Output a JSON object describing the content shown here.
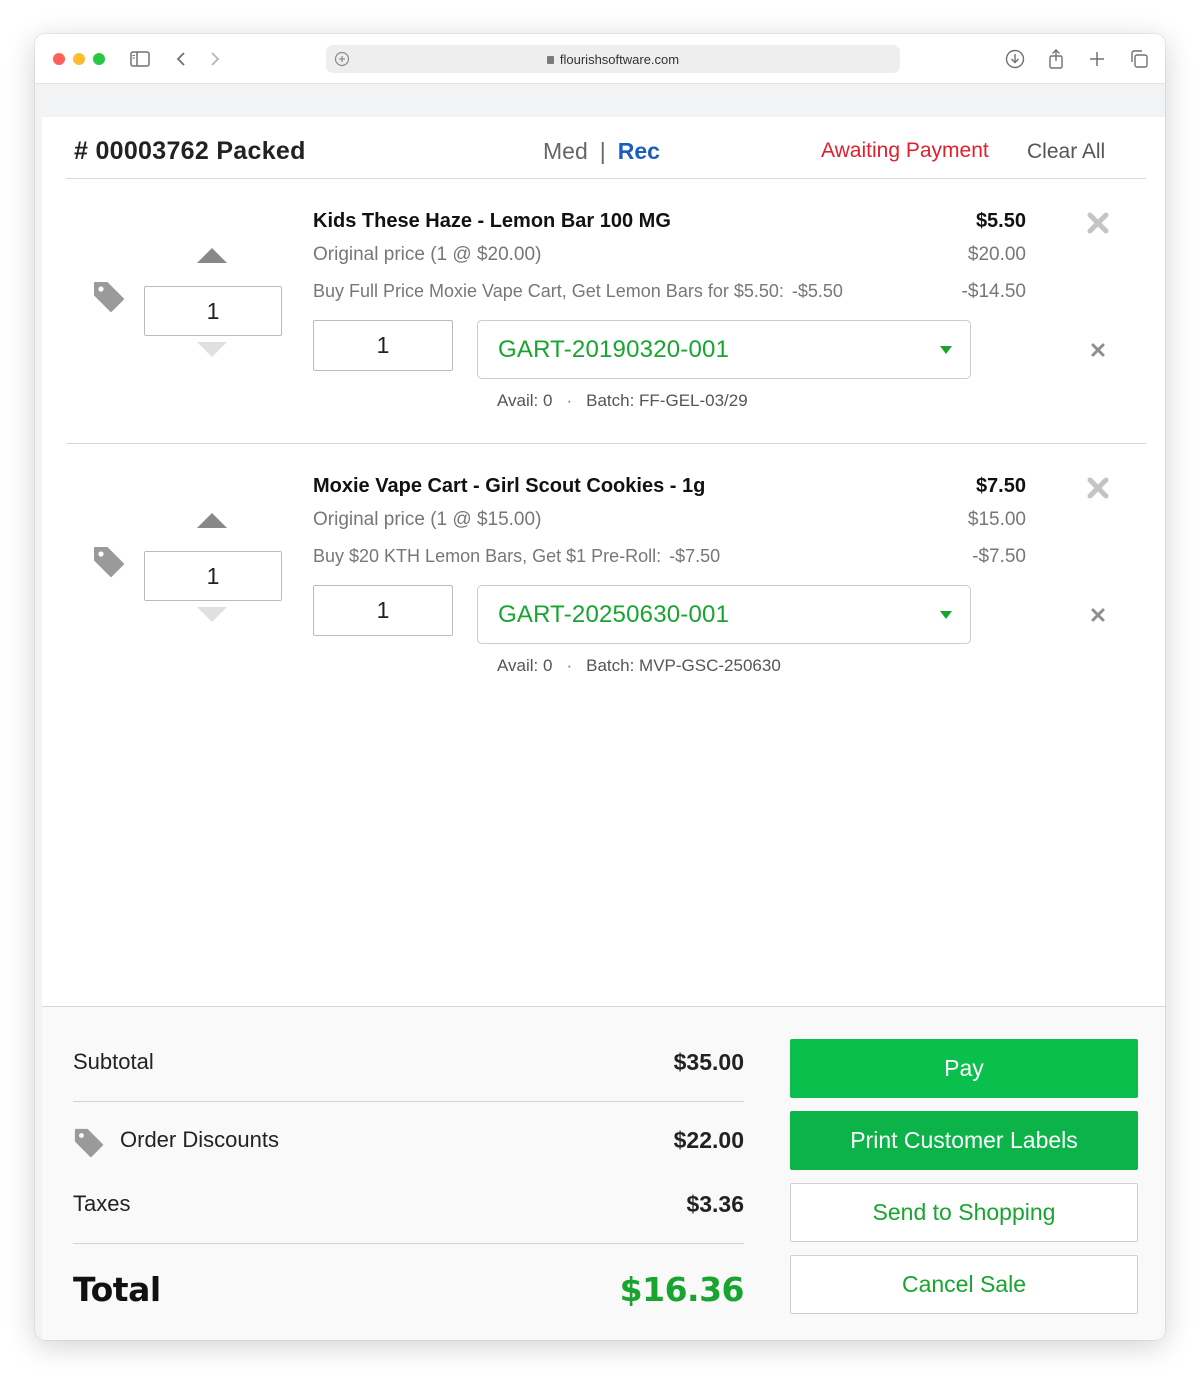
{
  "browser": {
    "url": "flourishsoftware.com",
    "icons": [
      "sidebar-icon",
      "back-icon",
      "forward-icon",
      "download-icon",
      "share-icon",
      "new-tab-icon",
      "tabs-icon"
    ]
  },
  "order": {
    "title": "# 00003762 Packed",
    "type_med": "Med",
    "type_sep": "|",
    "type_rec": "Rec",
    "status": "Awaiting Payment",
    "clear_all": "Clear All"
  },
  "items": [
    {
      "name": "Kids These Haze - Lemon Bar 100 MG",
      "original_price_text": "Original price (1 @ $20.00)",
      "promo_text": "Buy Full Price Moxie Vape Cart, Get Lemon Bars for $5.50:",
      "promo_amount": "-$5.50",
      "price": "$5.50",
      "price_original": "$20.00",
      "price_discount": "-$14.50",
      "quantity": "1",
      "lot_quantity": "1",
      "lot": "GART-20190320-001",
      "avail": "Avail: 0",
      "dot": "·",
      "batch": "Batch: FF-GEL-03/29"
    },
    {
      "name": "Moxie Vape Cart - Girl Scout Cookies - 1g",
      "original_price_text": "Original price (1 @ $15.00)",
      "promo_text": "Buy $20 KTH Lemon Bars, Get $1 Pre-Roll:",
      "promo_amount": "-$7.50",
      "price": "$7.50",
      "price_original": "$15.00",
      "price_discount": "-$7.50",
      "quantity": "1",
      "lot_quantity": "1",
      "lot": "GART-20250630-001",
      "avail": "Avail: 0",
      "dot": "·",
      "batch": "Batch: MVP-GSC-250630"
    }
  ],
  "summary": {
    "subtotal_label": "Subtotal",
    "subtotal_value": "$35.00",
    "discounts_label": "Order Discounts",
    "discounts_value": "$22.00",
    "taxes_label": "Taxes",
    "taxes_value": "$3.36",
    "total_label": "Total",
    "total_value": "$16.36"
  },
  "actions": {
    "pay": "Pay",
    "print_labels": "Print Customer Labels",
    "send_shopping": "Send to Shopping",
    "cancel_sale": "Cancel Sale"
  },
  "colors": {
    "accent_green": "#0bbf4c",
    "lot_green": "#17a52f",
    "status_red": "#e0202e",
    "rec_blue": "#1a5cc0"
  }
}
